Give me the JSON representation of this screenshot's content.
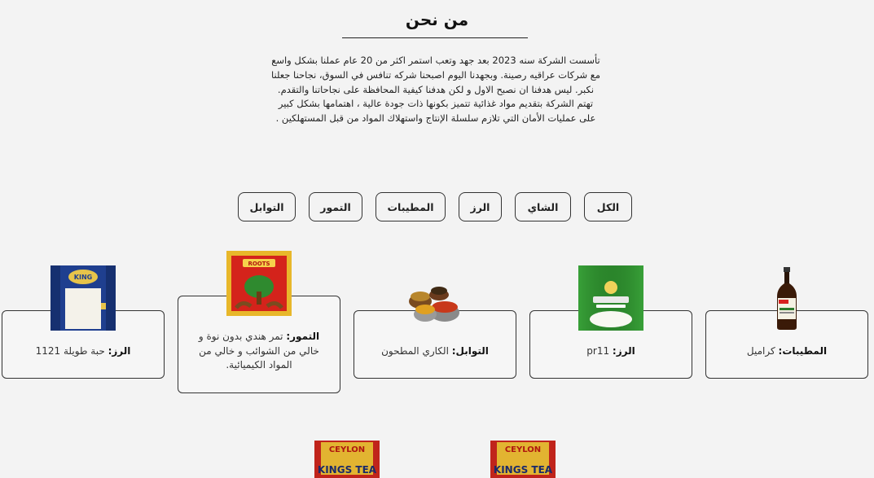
{
  "about": {
    "title": "من نحن",
    "body": "تأسست الشركة سنه 2023 بعد جهد وتعب استمر اكثر من 20 عام عملنا بشكل واسع مع شركات عراقيه رصينة. وبجهدنا اليوم اصبحنا شركه تنافس في السوق، نجاحنا جعلنا نكبر. ليس هدفنا ان نصبح الاول و لكن هدفنا كيفية المحافظة على نجاحاتنا والتقدم. تهتم الشركة بتقديم مواد غذائية تتميز بكونها ذات جودة عالية ، اهتمامها بشكل كبير على عمليات الأمان التي تلازم سلسلة الإنتاج واستهلاك المواد من قبل المستهلكين ."
  },
  "filters": [
    "الكل",
    "الشاي",
    "الرز",
    "المطيبات",
    "التمور",
    "التوابل"
  ],
  "products": [
    {
      "category": "المطيبات:",
      "name": " كراميل",
      "icon": "caramel-bottle-image"
    },
    {
      "category": "الرز:",
      "name": " pr11",
      "icon": "rice-bag-image"
    },
    {
      "category": "التوابل:",
      "name": " الكاري المطحون",
      "icon": "spices-bowls-image"
    },
    {
      "category": "التمور:",
      "name": " تمر هندي بدون نوة و خالي من الشوائب و خالي من المواد الكيميائية.",
      "icon": "roots-tamarind-box-image"
    },
    {
      "category": "الرز:",
      "name": " حبة طويلة 1121",
      "icon": "king-rice-bag-image"
    }
  ],
  "tea_row": [
    {
      "brand": "CEYLON",
      "label": "KINGS TEA",
      "icon": "ceylon-tea-box-image"
    },
    {
      "brand": "CEYLON",
      "label": "KINGS TEA",
      "icon": "ceylon-tea-box-image"
    }
  ],
  "colors": {
    "background": "#f3f3f3",
    "border": "#333333",
    "tea_red": "#c0241b",
    "tea_gold": "#e2b431"
  }
}
